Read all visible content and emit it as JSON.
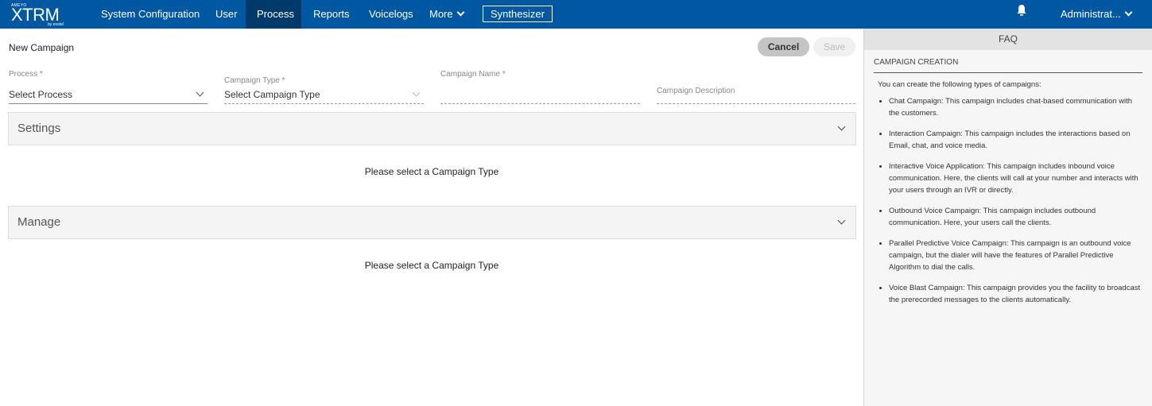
{
  "topbar": {
    "logo": {
      "brand_top": "AMEYO",
      "name": "XTRM",
      "brand_bottom": "by exotel"
    },
    "nav": [
      {
        "label": "System Configuration",
        "active": false
      },
      {
        "label": "User",
        "active": false
      },
      {
        "label": "Process",
        "active": true
      },
      {
        "label": "Reports",
        "active": false
      },
      {
        "label": "Voicelogs",
        "active": false
      },
      {
        "label": "More",
        "active": false
      }
    ],
    "synthesizer_label": "Synthesizer",
    "notification_icon": "bell-icon",
    "user_label": "Administrat..."
  },
  "form": {
    "title": "New Campaign",
    "cancel_label": "Cancel",
    "save_label": "Save",
    "process": {
      "label": "Process *",
      "value": "Select Process"
    },
    "campaign_type": {
      "label": "Campaign Type *",
      "value": "Select Campaign Type"
    },
    "campaign_name": {
      "label": "Campaign Name *",
      "value": ""
    },
    "campaign_description": {
      "label": "Campaign Description",
      "value": ""
    }
  },
  "sections": [
    {
      "title": "Settings",
      "message": "Please select a Campaign Type"
    },
    {
      "title": "Manage",
      "message": "Please select a Campaign Type"
    }
  ],
  "faq": {
    "header": "FAQ",
    "subtitle": "CAMPAIGN CREATION",
    "intro": "You can create the following types of campaigns:",
    "items": [
      "Chat Campaign: This campaign includes chat-based communication with the customers.",
      "Interaction Campaign: This campaign includes the interactions based on Email, chat, and voice media.",
      "Interactive Voice Application: This campaign includes inbound voice communication. Here, the clients will call at your number and interacts with your users through an IVR or directly.",
      "Outbound Voice Campaign: This campaign includes outbound communication. Here, your users call the clients.",
      "Parallel Predictive Voice Campaign: This campaign is an outbound voice campaign, but the dialer will have the features of Parallel Predictive Algorithm to dial the calls.",
      "Voice Blast Campaign: This campaign provides you the facility to broadcast the prerecorded messages to the clients automatically."
    ]
  }
}
